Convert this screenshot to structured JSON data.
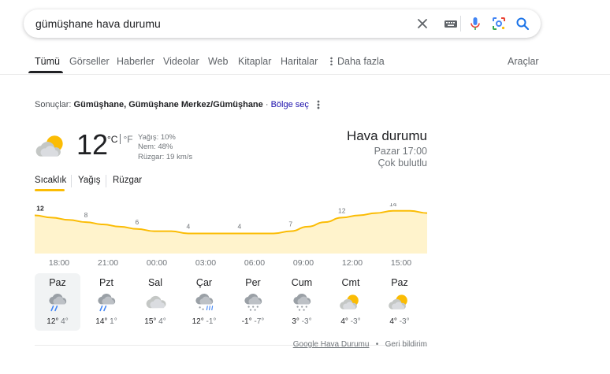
{
  "search": {
    "query": "gümüşhane hava durumu"
  },
  "tabs": [
    {
      "label": "Tümü",
      "active": true
    },
    {
      "label": "Görseller"
    },
    {
      "label": "Haberler"
    },
    {
      "label": "Videolar"
    },
    {
      "label": "Web"
    },
    {
      "label": "Kitaplar"
    },
    {
      "label": "Haritalar"
    },
    {
      "label": "Daha fazla"
    }
  ],
  "tools_label": "Araçlar",
  "results": {
    "prefix": "Sonuçlar:",
    "location": "Gümüşhane, Gümüşhane Merkez/Gümüşhane",
    "dot": " · ",
    "region_link": "Bölge seç"
  },
  "current": {
    "temp": "12",
    "unit_c": "°C",
    "unit_f": "°F",
    "precip": "Yağış: 10%",
    "humidity": "Nem: 48%",
    "wind": "Rüzgar: 19 km/s",
    "title": "Hava durumu",
    "time": "Pazar 17:00",
    "condition": "Çok bulutlu",
    "icon": "partly-cloudy-icon"
  },
  "subtabs": [
    "Sıcaklık",
    "Yağış",
    "Rüzgar"
  ],
  "chart_data": {
    "type": "area",
    "x": [
      "17:00",
      "18:00",
      "19:00",
      "20:00",
      "21:00",
      "22:00",
      "23:00",
      "00:00",
      "01:00",
      "02:00",
      "03:00",
      "04:00",
      "05:00",
      "06:00",
      "07:00",
      "08:00",
      "09:00",
      "10:00",
      "11:00",
      "12:00",
      "13:00",
      "14:00",
      "15:00",
      "16:00"
    ],
    "values": [
      12,
      11,
      10,
      9,
      8,
      7,
      6,
      5,
      5,
      4,
      4,
      4,
      4,
      4,
      4,
      5,
      7,
      9,
      11,
      12,
      13,
      14,
      14,
      13
    ],
    "labels": [
      "12",
      "8",
      "6",
      "4",
      "4",
      "7",
      "12",
      "14"
    ],
    "label_x": [
      "17:00",
      "20:00",
      "23:00",
      "02:00",
      "05:00",
      "08:00",
      "11:00",
      "14:00"
    ],
    "hour_ticks": [
      "18:00",
      "21:00",
      "00:00",
      "03:00",
      "06:00",
      "09:00",
      "12:00",
      "15:00"
    ],
    "line_color": "#fbbc04",
    "fill_color": "#fff3cc"
  },
  "days": [
    {
      "name": "Paz",
      "hi": "12°",
      "lo": "4°",
      "icon": "rain-cloud-icon",
      "selected": true
    },
    {
      "name": "Pzt",
      "hi": "14°",
      "lo": "1°",
      "icon": "rain-cloud-icon"
    },
    {
      "name": "Sal",
      "hi": "15°",
      "lo": "4°",
      "icon": "cloud-icon"
    },
    {
      "name": "Çar",
      "hi": "12°",
      "lo": "-1°",
      "icon": "sleet-cloud-icon"
    },
    {
      "name": "Per",
      "hi": "-1°",
      "lo": "-7°",
      "icon": "snow-cloud-icon"
    },
    {
      "name": "Cum",
      "hi": "3°",
      "lo": "-3°",
      "icon": "snow-cloud-icon"
    },
    {
      "name": "Cmt",
      "hi": "4°",
      "lo": "-3°",
      "icon": "partly-cloudy-icon"
    },
    {
      "name": "Paz",
      "hi": "4°",
      "lo": "-3°",
      "icon": "partly-cloudy-icon"
    }
  ],
  "footer": {
    "source": "Google Hava Durumu",
    "bullet": "•",
    "feedback": "Geri bildirim"
  },
  "colors": {
    "accent_blue": "#1a73e8",
    "link": "#1a0dab",
    "sun": "#fbbc04",
    "cloud": "#c4c7c5",
    "rain": "#4285f4"
  }
}
